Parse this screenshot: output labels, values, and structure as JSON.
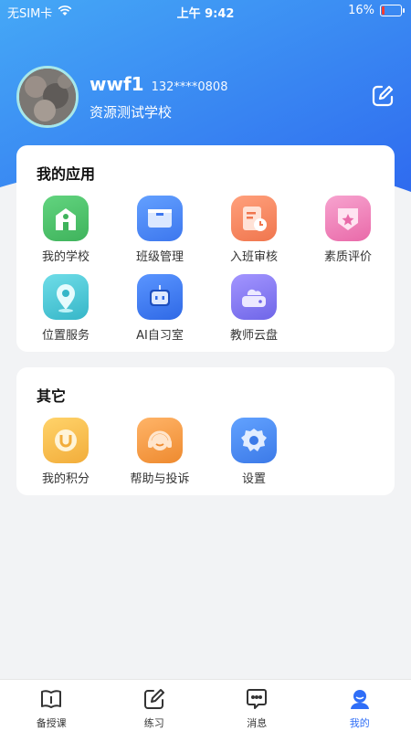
{
  "status": {
    "carrier": "无SIM卡",
    "time": "上午 9:42",
    "battery": "16%",
    "battery_level": 0.16
  },
  "profile": {
    "name": "wwf1",
    "phone": "132****0808",
    "school": "资源测试学校"
  },
  "apps": {
    "title": "我的应用",
    "items": [
      {
        "label": "我的学校",
        "icon": "school-icon",
        "color": "#4cc26a"
      },
      {
        "label": "班级管理",
        "icon": "class-board-icon",
        "color": "#4a86f5"
      },
      {
        "label": "入班审核",
        "icon": "review-clock-icon",
        "color": "#f48a63"
      },
      {
        "label": "素质评价",
        "icon": "badge-star-icon",
        "color": "#ee7fb8"
      },
      {
        "label": "位置服务",
        "icon": "location-pin-icon",
        "color": "#49c6d6"
      },
      {
        "label": "AI自习室",
        "icon": "robot-icon",
        "color": "#3f7df2"
      },
      {
        "label": "教师云盘",
        "icon": "cloud-drive-icon",
        "color": "#8a7cf0"
      }
    ]
  },
  "others": {
    "title": "其它",
    "items": [
      {
        "label": "我的积分",
        "icon": "points-icon",
        "color": "#f6c04f"
      },
      {
        "label": "帮助与投诉",
        "icon": "headset-icon",
        "color": "#f39a43"
      },
      {
        "label": "设置",
        "icon": "gear-icon",
        "color": "#4c8ef0"
      }
    ]
  },
  "tabs": [
    {
      "label": "备授课",
      "icon": "book-icon"
    },
    {
      "label": "练习",
      "icon": "pencil-icon"
    },
    {
      "label": "消息",
      "icon": "message-icon"
    },
    {
      "label": "我的",
      "icon": "user-icon",
      "active": true
    }
  ],
  "colors": {
    "accent": "#2f6ef7",
    "hero_top": "#4aa7f5",
    "hero_bottom": "#2f6ef7"
  }
}
